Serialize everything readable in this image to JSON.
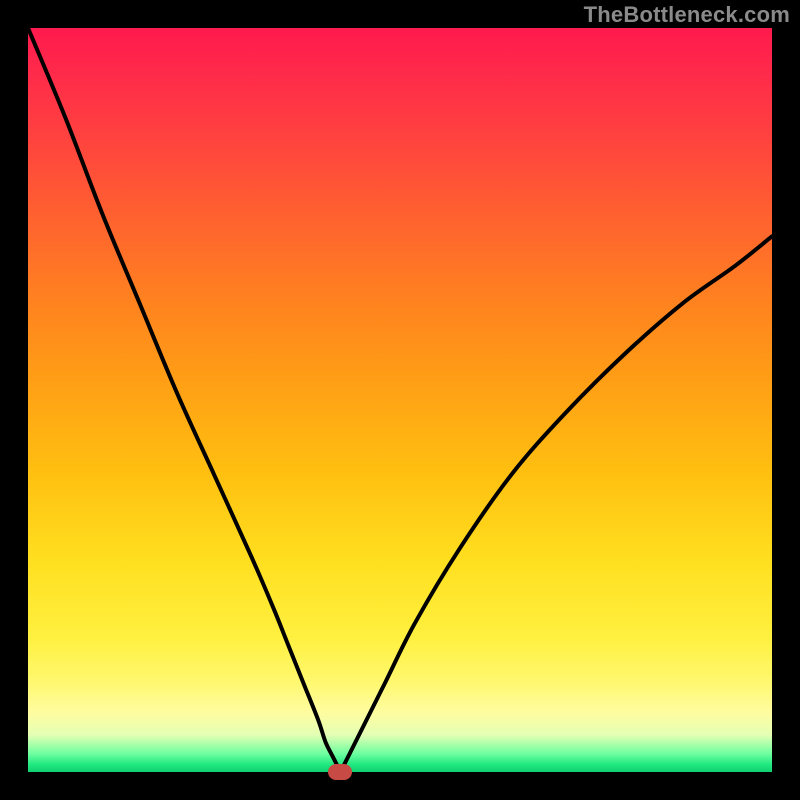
{
  "watermark": "TheBottleneck.com",
  "chart_data": {
    "type": "line",
    "title": "",
    "xlabel": "",
    "ylabel": "",
    "xlim": [
      0,
      100
    ],
    "ylim": [
      0,
      100
    ],
    "series": [
      {
        "name": "bottleneck-curve",
        "x": [
          0,
          5,
          10,
          15,
          20,
          25,
          30,
          33,
          35,
          37,
          39,
          40,
          41,
          42,
          42,
          43,
          45,
          48,
          52,
          58,
          65,
          72,
          80,
          88,
          95,
          100
        ],
        "y": [
          100,
          88,
          75,
          63,
          51,
          40,
          29,
          22,
          17,
          12,
          7,
          4,
          2,
          0,
          0,
          2,
          6,
          12,
          20,
          30,
          40,
          48,
          56,
          63,
          68,
          72
        ]
      }
    ],
    "marker": {
      "x": 42,
      "y": 0
    },
    "gradient_stops": [
      {
        "pos": 0,
        "color": "#ff1a4d"
      },
      {
        "pos": 50,
        "color": "#ffb010"
      },
      {
        "pos": 90,
        "color": "#fff870"
      },
      {
        "pos": 100,
        "color": "#10d070"
      }
    ]
  }
}
